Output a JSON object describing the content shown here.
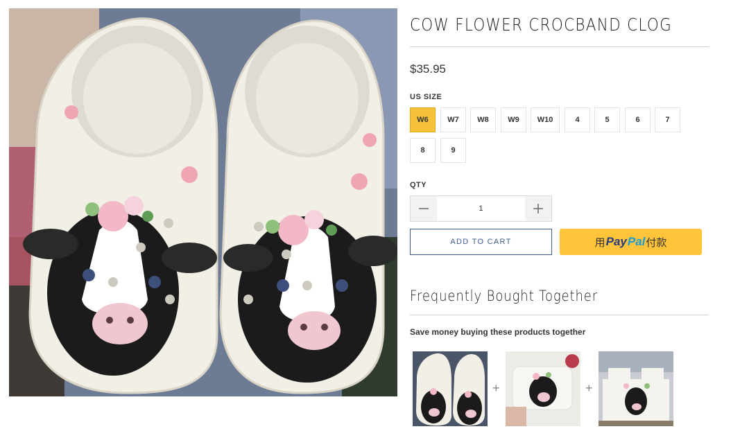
{
  "product": {
    "title": "COW FLOWER CROCBAND CLOG",
    "price": "$35.95",
    "image_alt": "Cow Flower Crocband Clog product photo",
    "size_label": "US SIZE",
    "sizes": [
      "W6",
      "W7",
      "W8",
      "W9",
      "W10",
      "4",
      "5",
      "6",
      "7",
      "8",
      "9"
    ],
    "selected_size": "W6",
    "qty_label": "QTY",
    "quantity": "1",
    "add_to_cart_label": "ADD TO CART",
    "paypal": {
      "prefix": "用",
      "pay": "Pay",
      "pal": "Pal",
      "suffix": "付款"
    }
  },
  "bundle": {
    "title": "Frequently Bought Together",
    "subtitle": "Save money buying these products together",
    "items": [
      {
        "name": "Cow Flower Crocband Clog"
      },
      {
        "name": "Cow flower face mask"
      },
      {
        "name": "Cow flower bedding set"
      }
    ],
    "plus_symbol": "+"
  },
  "colors": {
    "accent": "#f7c23a",
    "paypal": "#ffc439",
    "cart_border": "#3a5a8a"
  },
  "icons": {
    "minus": "minus-icon",
    "plus": "plus-icon"
  }
}
